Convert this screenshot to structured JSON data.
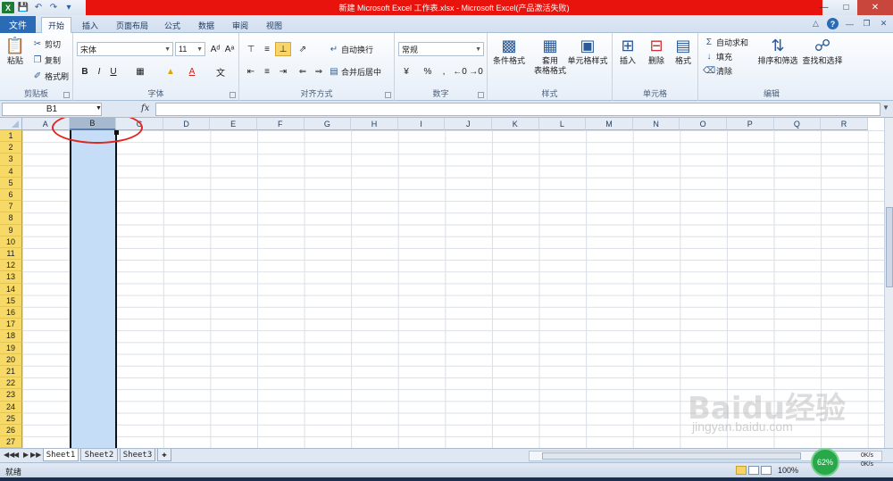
{
  "titlebar": {
    "title": "新建 Microsoft Excel 工作表.xlsx - Microsoft Excel(产品激活失败)",
    "app_logo": "X"
  },
  "tabs": {
    "file": "文件",
    "items": [
      "开始",
      "插入",
      "页面布局",
      "公式",
      "数据",
      "审阅",
      "视图"
    ],
    "active": "开始"
  },
  "ribbon": {
    "clipboard": {
      "paste": "粘贴",
      "cut": "剪切",
      "copy": "复制",
      "format_painter": "格式刷",
      "label": "剪贴板"
    },
    "font": {
      "name": "宋体",
      "size": "11",
      "bold": "B",
      "italic": "I",
      "underline": "U",
      "label": "字体"
    },
    "alignment": {
      "wrap": "自动换行",
      "merge": "合并后居中",
      "label": "对齐方式"
    },
    "number": {
      "format": "常规",
      "percent": "%",
      "comma": ",",
      "label": "数字"
    },
    "styles": {
      "conditional": "条件格式",
      "table_1": "套用",
      "table_2": "表格格式",
      "cell_styles": "单元格样式",
      "label": "样式"
    },
    "cells": {
      "insert": "插入",
      "delete": "删除",
      "format": "格式",
      "label": "单元格"
    },
    "editing": {
      "autosum": "自动求和",
      "fill": "填充",
      "clear": "清除",
      "sort": "排序和筛选",
      "find": "查找和选择",
      "label": "编辑"
    }
  },
  "formula_bar": {
    "name_box": "B1",
    "fx": "fx",
    "value": ""
  },
  "grid": {
    "columns": [
      "A",
      "B",
      "C",
      "D",
      "E",
      "F",
      "G",
      "H",
      "I",
      "J",
      "K",
      "L",
      "M",
      "N",
      "O",
      "P",
      "Q",
      "R"
    ],
    "rows": [
      "1",
      "2",
      "3",
      "4",
      "5",
      "6",
      "7",
      "8",
      "9",
      "10",
      "11",
      "12",
      "13",
      "14",
      "15",
      "16",
      "17",
      "18",
      "19",
      "20",
      "21",
      "22",
      "23",
      "24",
      "25",
      "26",
      "27"
    ],
    "selected_column": "B"
  },
  "sheets": {
    "tabs": [
      "Sheet1",
      "Sheet2",
      "Sheet3"
    ],
    "active": "Sheet1"
  },
  "status": {
    "text": "就绪",
    "zoom": "100%",
    "zoom_badge": "62%",
    "net_up": "0K/s",
    "net_down": "0K/s"
  },
  "watermark": {
    "text": "Baidu经验",
    "sub": "jingyan.baidu.com"
  },
  "colors": {
    "title_red": "#e8130d",
    "file_blue": "#2b6bb5",
    "selection": "#c5ddf7",
    "highlight_circle": "#e0241e",
    "row_header": "#f6d966"
  }
}
